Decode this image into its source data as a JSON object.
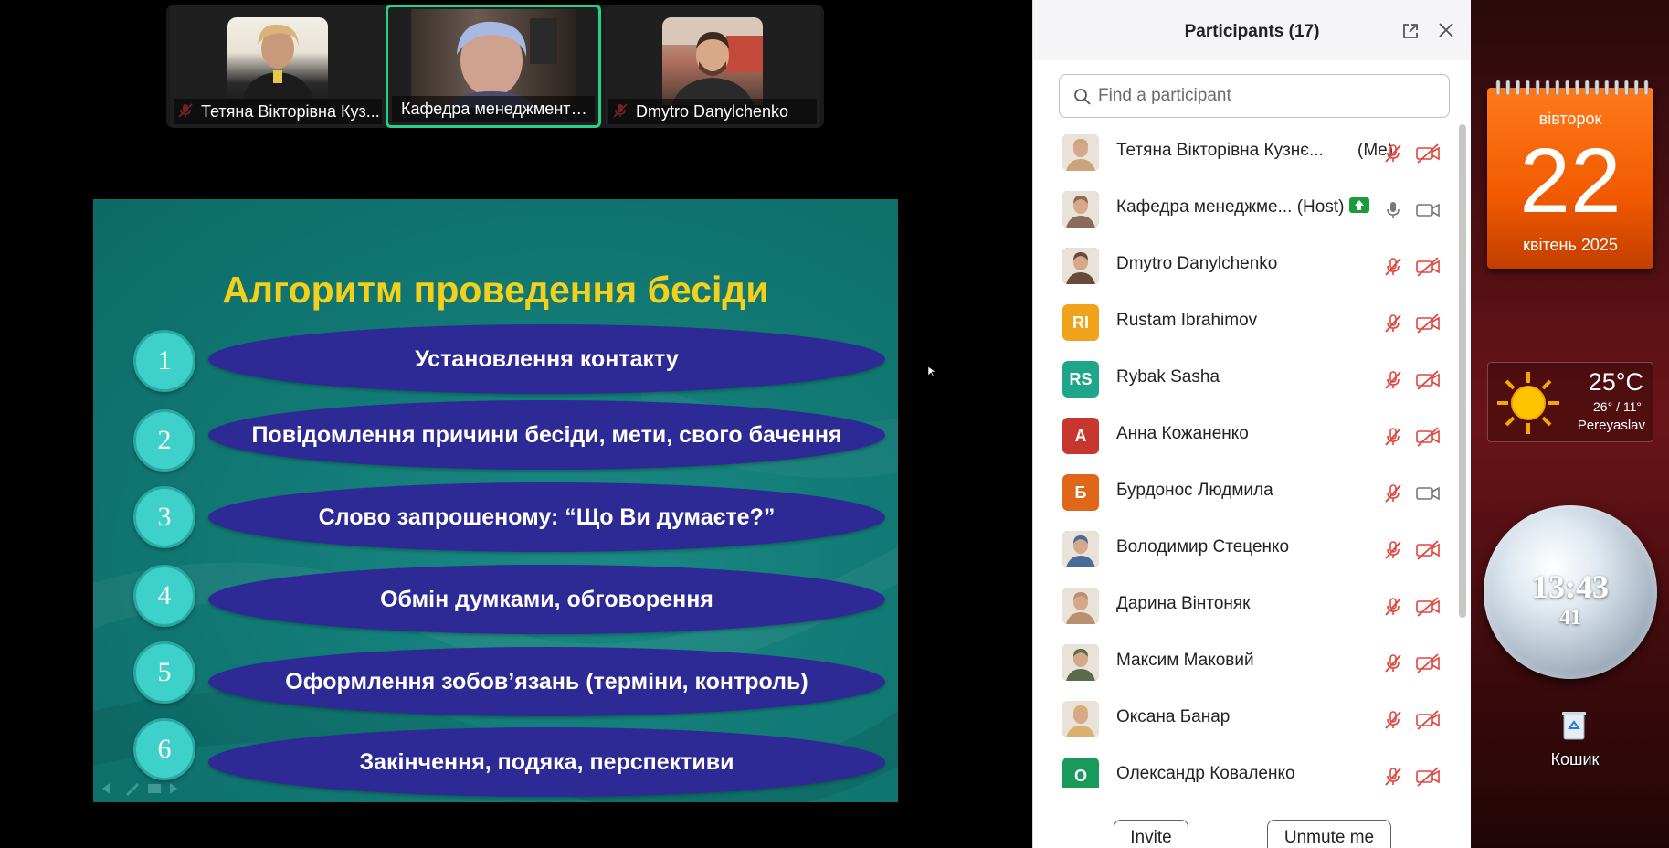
{
  "meeting": {
    "video_tiles": [
      {
        "name": "Тетяна Вікторівна Кузнєцова",
        "display": "Тетяна Вікторівна Куз...",
        "muted": true,
        "active": false
      },
      {
        "name": "Кафедра менеджменту т...",
        "display": "Кафедра менеджменту т...",
        "muted": false,
        "active": true
      },
      {
        "name": "Dmytro Danylchenko",
        "display": "Dmytro Danylchenko",
        "muted": true,
        "active": false
      }
    ],
    "slide": {
      "title": "Алгоритм проведення бесіди",
      "steps": [
        {
          "num": "1",
          "label": "Установлення контакту"
        },
        {
          "num": "2",
          "label": "Повідомлення причини бесіди, мети, свого бачення"
        },
        {
          "num": "3",
          "label": "Слово запрошеному: “Що Ви думаєте?”"
        },
        {
          "num": "4",
          "label": "Обмін думками, обговорення"
        },
        {
          "num": "5",
          "label": "Оформлення зобов’язань (терміни, контроль)"
        },
        {
          "num": "6",
          "label": "Закінчення, подяка, перспективи"
        }
      ],
      "colors": {
        "title": "#f4d01a",
        "oval": "#2d2a96",
        "circle": "#3ed1c9",
        "background": "#127a76"
      }
    }
  },
  "panel": {
    "title": "Participants (17)",
    "search_placeholder": "Find a participant",
    "participants": [
      {
        "name": "Тетяна Вікторівна Кузнє...",
        "tag": "(Me)",
        "avatar": "photo",
        "initials": "",
        "color": "#c9a37a",
        "mic": "off",
        "cam": "off",
        "badge": false
      },
      {
        "name": "Кафедра менеджме...",
        "tag": "(Host)",
        "avatar": "photo",
        "initials": "",
        "color": "#8a6a5a",
        "mic": "on",
        "cam": "on",
        "badge": true
      },
      {
        "name": "Dmytro Danylchenko",
        "tag": "",
        "avatar": "photo",
        "initials": "",
        "color": "#6a4a3a",
        "mic": "off",
        "cam": "off",
        "badge": false
      },
      {
        "name": "Rustam Ibrahimov",
        "tag": "",
        "avatar": "initials",
        "initials": "RI",
        "color": "#f0a21a",
        "mic": "off",
        "cam": "off",
        "badge": false
      },
      {
        "name": "Rybak Sasha",
        "tag": "",
        "avatar": "initials",
        "initials": "RS",
        "color": "#1fa58a",
        "mic": "off",
        "cam": "off",
        "badge": false
      },
      {
        "name": "Анна Кожаненко",
        "tag": "",
        "avatar": "initials",
        "initials": "А",
        "color": "#c8372d",
        "mic": "off",
        "cam": "off",
        "badge": false
      },
      {
        "name": "Бурдонос Людмила",
        "tag": "",
        "avatar": "initials",
        "initials": "Б",
        "color": "#e0661a",
        "mic": "off",
        "cam": "on",
        "badge": false
      },
      {
        "name": "Володимир Стеценко",
        "tag": "",
        "avatar": "photo",
        "initials": "",
        "color": "#4a6a9a",
        "mic": "off",
        "cam": "off",
        "badge": false
      },
      {
        "name": "Дарина Вінтоняк",
        "tag": "",
        "avatar": "photo",
        "initials": "",
        "color": "#b89070",
        "mic": "off",
        "cam": "off",
        "badge": false
      },
      {
        "name": "Максим Маковий",
        "tag": "",
        "avatar": "photo",
        "initials": "",
        "color": "#5a6a4a",
        "mic": "off",
        "cam": "off",
        "badge": false
      },
      {
        "name": "Оксана Банар",
        "tag": "",
        "avatar": "photo",
        "initials": "",
        "color": "#d8b070",
        "mic": "off",
        "cam": "off",
        "badge": false
      },
      {
        "name": "Олександр Коваленко",
        "tag": "",
        "avatar": "initials",
        "initials": "О",
        "color": "#1a9a5a",
        "mic": "off",
        "cam": "off",
        "badge": false
      }
    ],
    "buttons": {
      "invite": "Invite",
      "unmute": "Unmute me"
    },
    "icons": {
      "popout": "popout-icon",
      "close": "close-icon",
      "search": "search-icon",
      "mic_off": "mic-off-icon",
      "cam_off": "camera-off-icon",
      "share": "screen-share-icon"
    }
  },
  "desktop": {
    "calendar": {
      "day": "вівторок",
      "date": "22",
      "month": "квітень 2025"
    },
    "weather": {
      "temp": "25°C",
      "range": "26° / 11°",
      "city": "Pereyaslav"
    },
    "clock": {
      "time": "13:43",
      "seconds": "41"
    },
    "recycle_bin": "Кошик"
  }
}
